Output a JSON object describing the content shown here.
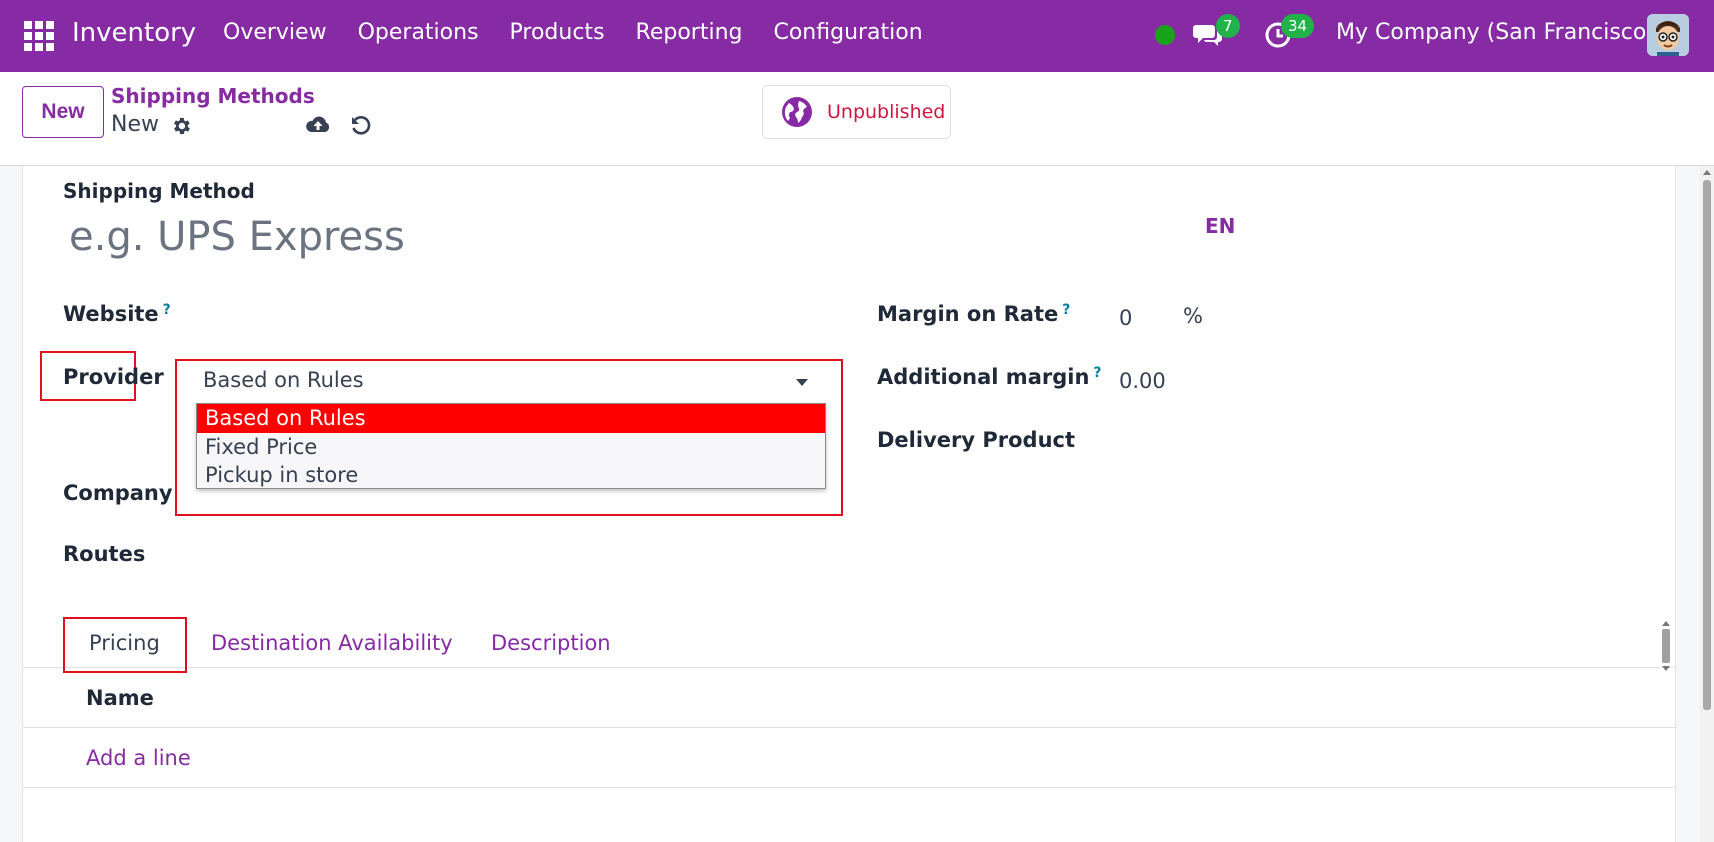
{
  "navbar": {
    "brand": "Inventory",
    "menu": [
      "Overview",
      "Operations",
      "Products",
      "Reporting",
      "Configuration"
    ],
    "messages_count": "7",
    "activities_count": "34",
    "company": "My Company (San Francisco)",
    "bg_color": "#862ba3"
  },
  "control": {
    "new_label": "New",
    "breadcrumb": "Shipping Methods",
    "record_name": "New",
    "publish_status": "Unpublished"
  },
  "form": {
    "shipping_method_label": "Shipping Method",
    "name_placeholder": "e.g. UPS Express",
    "lang": "EN",
    "website_label": "Website",
    "provider_label": "Provider",
    "provider_value": "Based on Rules",
    "provider_options": [
      "Based on Rules",
      "Fixed Price",
      "Pickup in store"
    ],
    "company_label": "Company",
    "routes_label": "Routes",
    "margin_rate_label": "Margin on Rate",
    "margin_rate_value": "0",
    "margin_rate_unit": "%",
    "additional_margin_label": "Additional margin",
    "additional_margin_value": "0.00",
    "delivery_product_label": "Delivery Product",
    "help_mark": "?"
  },
  "tabs": [
    "Pricing",
    "Destination Availability",
    "Description"
  ],
  "table": {
    "header_name": "Name",
    "add_line": "Add a line"
  },
  "colors": {
    "accent": "#862ba3",
    "highlight_red": "#e0111d",
    "selected_option": "#fe0000",
    "unpublished": "#d0163d"
  }
}
